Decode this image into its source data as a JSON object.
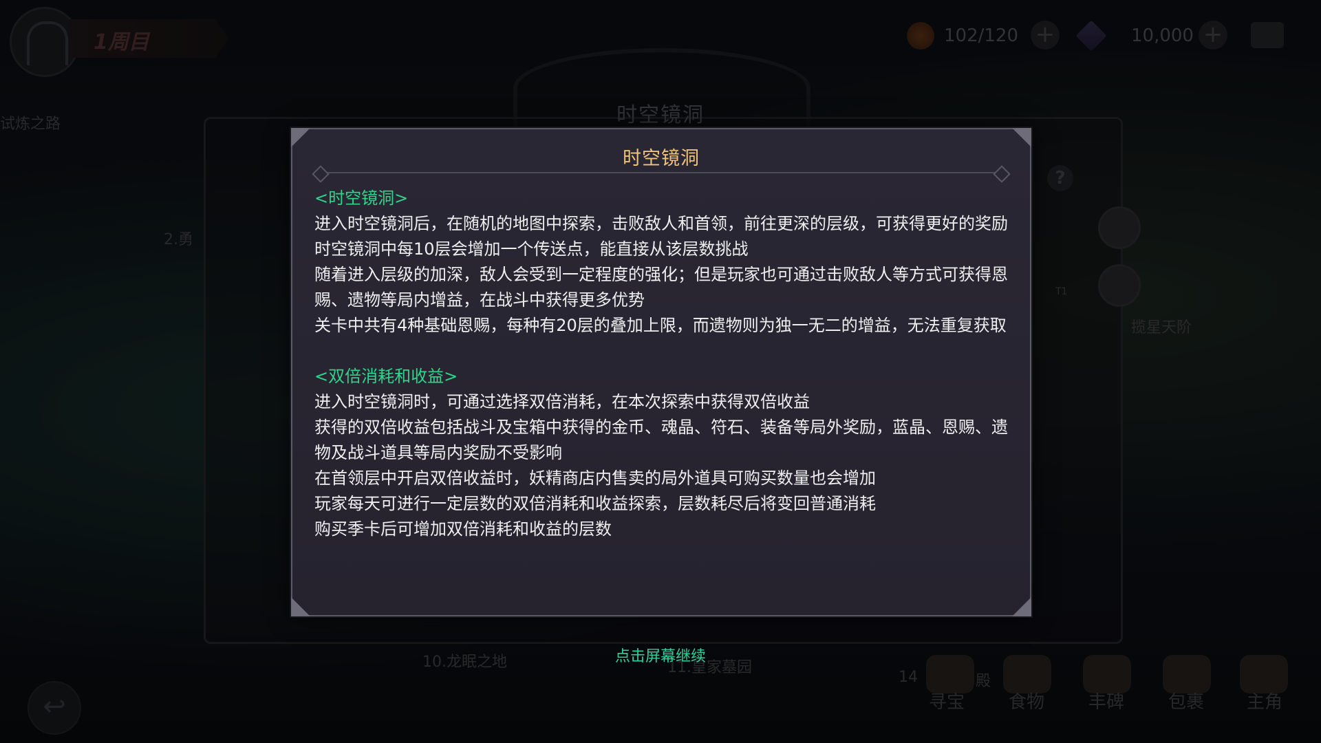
{
  "top_bar": {
    "cycle_label": "1周目",
    "stamina_value": "102/120",
    "gem_value": "10,000"
  },
  "background_labels": {
    "left_route": "试炼之路",
    "level_2": "2.勇",
    "level_10": "10.龙眠之地",
    "level_11": "11.皇家墓园",
    "level_14": "14",
    "level_14_suffix": "殿",
    "right_place": "揽星天阶",
    "tag_t1": "T1"
  },
  "outer_panel": {
    "title": "时空镜洞",
    "help": "?"
  },
  "bottom_nav": [
    {
      "label": "寻宝"
    },
    {
      "label": "食物"
    },
    {
      "label": "丰碑"
    },
    {
      "label": "包裹"
    },
    {
      "label": "主角"
    }
  ],
  "dialog": {
    "title": "时空镜洞",
    "section1_heading": "<时空镜洞>",
    "section1_p1": "进入时空镜洞后，在随机的地图中探索，击败敌人和首领，前往更深的层级，可获得更好的奖励",
    "section1_p2": "时空镜洞中每10层会增加一个传送点，能直接从该层数挑战",
    "section1_p3": "随着进入层级的加深，敌人会受到一定程度的强化；但是玩家也可通过击败敌人等方式可获得恩赐、遗物等局内增益，在战斗中获得更多优势",
    "section1_p4": "关卡中共有4种基础恩赐，每种有20层的叠加上限，而遗物则为独一无二的增益，无法重复获取",
    "section2_heading": "<双倍消耗和收益>",
    "section2_p1": "进入时空镜洞时，可通过选择双倍消耗，在本次探索中获得双倍收益",
    "section2_p2": "获得的双倍收益包括战斗及宝箱中获得的金币、魂晶、符石、装备等局外奖励，蓝晶、恩赐、遗物及战斗道具等局内奖励不受影响",
    "section2_p3": "在首领层中开启双倍收益时，妖精商店内售卖的局外道具可购买数量也会增加",
    "section2_p4": "玩家每天可进行一定层数的双倍消耗和收益探索，层数耗尽后将变回普通消耗",
    "section2_p5": "购买季卡后可增加双倍消耗和收益的层数"
  },
  "continue_hint": "点击屏幕继续",
  "colors": {
    "dialog_title": "#f0c27a",
    "section_heading": "#2fd58a",
    "body_text": "#efefef",
    "hint": "#2fd0a0"
  }
}
